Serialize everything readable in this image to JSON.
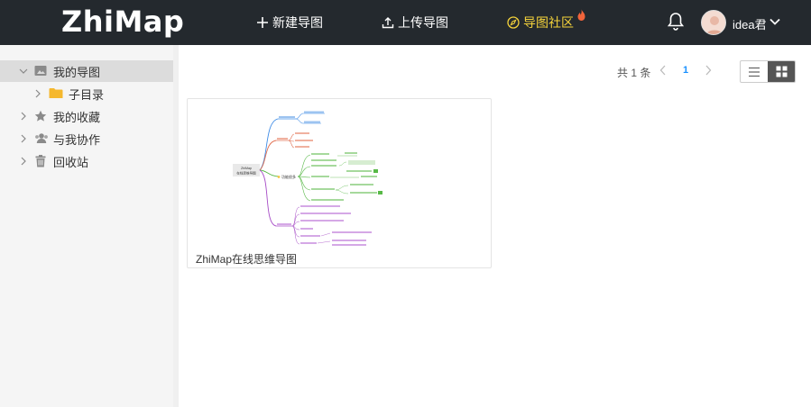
{
  "app": {
    "logo": "ZhiMap"
  },
  "topnav": {
    "new_map": "新建导图",
    "upload_map": "上传导图",
    "community": "导图社区",
    "username": "idea君"
  },
  "sidebar": {
    "items": [
      {
        "label": "我的导图",
        "icon": "folder-image-icon",
        "expanded": true,
        "active": true
      },
      {
        "label": "子目录",
        "icon": "folder-icon",
        "child": true
      },
      {
        "label": "我的收藏",
        "icon": "star-icon"
      },
      {
        "label": "与我协作",
        "icon": "users-icon"
      },
      {
        "label": "回收站",
        "icon": "trash-icon"
      }
    ]
  },
  "pagination": {
    "total": "共 1 条",
    "current": "1"
  },
  "cards": [
    {
      "title": "ZhiMap在线思维导图",
      "thumb": {
        "root_line1": "ZhiMap",
        "root_line2": "在线思维导图",
        "mid_node": "功能很多"
      }
    }
  ],
  "colors": {
    "accent": "#1890ff",
    "community": "#f5d33b",
    "topbar": "#24292e"
  }
}
